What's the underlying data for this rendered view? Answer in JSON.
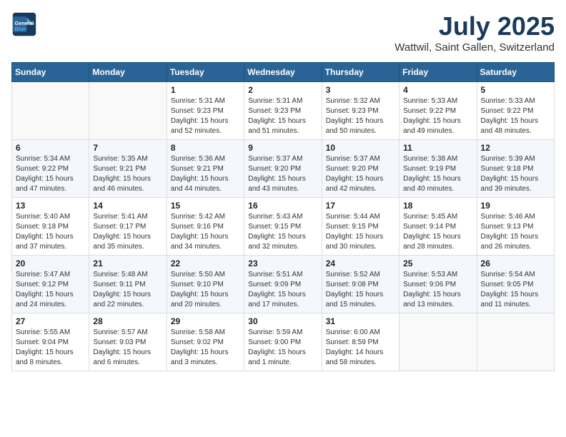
{
  "header": {
    "logo_line1": "General",
    "logo_line2": "Blue",
    "month_year": "July 2025",
    "location": "Wattwil, Saint Gallen, Switzerland"
  },
  "weekdays": [
    "Sunday",
    "Monday",
    "Tuesday",
    "Wednesday",
    "Thursday",
    "Friday",
    "Saturday"
  ],
  "weeks": [
    [
      {
        "day": "",
        "text": ""
      },
      {
        "day": "",
        "text": ""
      },
      {
        "day": "1",
        "text": "Sunrise: 5:31 AM\nSunset: 9:23 PM\nDaylight: 15 hours\nand 52 minutes."
      },
      {
        "day": "2",
        "text": "Sunrise: 5:31 AM\nSunset: 9:23 PM\nDaylight: 15 hours\nand 51 minutes."
      },
      {
        "day": "3",
        "text": "Sunrise: 5:32 AM\nSunset: 9:23 PM\nDaylight: 15 hours\nand 50 minutes."
      },
      {
        "day": "4",
        "text": "Sunrise: 5:33 AM\nSunset: 9:22 PM\nDaylight: 15 hours\nand 49 minutes."
      },
      {
        "day": "5",
        "text": "Sunrise: 5:33 AM\nSunset: 9:22 PM\nDaylight: 15 hours\nand 48 minutes."
      }
    ],
    [
      {
        "day": "6",
        "text": "Sunrise: 5:34 AM\nSunset: 9:22 PM\nDaylight: 15 hours\nand 47 minutes."
      },
      {
        "day": "7",
        "text": "Sunrise: 5:35 AM\nSunset: 9:21 PM\nDaylight: 15 hours\nand 46 minutes."
      },
      {
        "day": "8",
        "text": "Sunrise: 5:36 AM\nSunset: 9:21 PM\nDaylight: 15 hours\nand 44 minutes."
      },
      {
        "day": "9",
        "text": "Sunrise: 5:37 AM\nSunset: 9:20 PM\nDaylight: 15 hours\nand 43 minutes."
      },
      {
        "day": "10",
        "text": "Sunrise: 5:37 AM\nSunset: 9:20 PM\nDaylight: 15 hours\nand 42 minutes."
      },
      {
        "day": "11",
        "text": "Sunrise: 5:38 AM\nSunset: 9:19 PM\nDaylight: 15 hours\nand 40 minutes."
      },
      {
        "day": "12",
        "text": "Sunrise: 5:39 AM\nSunset: 9:18 PM\nDaylight: 15 hours\nand 39 minutes."
      }
    ],
    [
      {
        "day": "13",
        "text": "Sunrise: 5:40 AM\nSunset: 9:18 PM\nDaylight: 15 hours\nand 37 minutes."
      },
      {
        "day": "14",
        "text": "Sunrise: 5:41 AM\nSunset: 9:17 PM\nDaylight: 15 hours\nand 35 minutes."
      },
      {
        "day": "15",
        "text": "Sunrise: 5:42 AM\nSunset: 9:16 PM\nDaylight: 15 hours\nand 34 minutes."
      },
      {
        "day": "16",
        "text": "Sunrise: 5:43 AM\nSunset: 9:15 PM\nDaylight: 15 hours\nand 32 minutes."
      },
      {
        "day": "17",
        "text": "Sunrise: 5:44 AM\nSunset: 9:15 PM\nDaylight: 15 hours\nand 30 minutes."
      },
      {
        "day": "18",
        "text": "Sunrise: 5:45 AM\nSunset: 9:14 PM\nDaylight: 15 hours\nand 28 minutes."
      },
      {
        "day": "19",
        "text": "Sunrise: 5:46 AM\nSunset: 9:13 PM\nDaylight: 15 hours\nand 26 minutes."
      }
    ],
    [
      {
        "day": "20",
        "text": "Sunrise: 5:47 AM\nSunset: 9:12 PM\nDaylight: 15 hours\nand 24 minutes."
      },
      {
        "day": "21",
        "text": "Sunrise: 5:48 AM\nSunset: 9:11 PM\nDaylight: 15 hours\nand 22 minutes."
      },
      {
        "day": "22",
        "text": "Sunrise: 5:50 AM\nSunset: 9:10 PM\nDaylight: 15 hours\nand 20 minutes."
      },
      {
        "day": "23",
        "text": "Sunrise: 5:51 AM\nSunset: 9:09 PM\nDaylight: 15 hours\nand 17 minutes."
      },
      {
        "day": "24",
        "text": "Sunrise: 5:52 AM\nSunset: 9:08 PM\nDaylight: 15 hours\nand 15 minutes."
      },
      {
        "day": "25",
        "text": "Sunrise: 5:53 AM\nSunset: 9:06 PM\nDaylight: 15 hours\nand 13 minutes."
      },
      {
        "day": "26",
        "text": "Sunrise: 5:54 AM\nSunset: 9:05 PM\nDaylight: 15 hours\nand 11 minutes."
      }
    ],
    [
      {
        "day": "27",
        "text": "Sunrise: 5:55 AM\nSunset: 9:04 PM\nDaylight: 15 hours\nand 8 minutes."
      },
      {
        "day": "28",
        "text": "Sunrise: 5:57 AM\nSunset: 9:03 PM\nDaylight: 15 hours\nand 6 minutes."
      },
      {
        "day": "29",
        "text": "Sunrise: 5:58 AM\nSunset: 9:02 PM\nDaylight: 15 hours\nand 3 minutes."
      },
      {
        "day": "30",
        "text": "Sunrise: 5:59 AM\nSunset: 9:00 PM\nDaylight: 15 hours\nand 1 minute."
      },
      {
        "day": "31",
        "text": "Sunrise: 6:00 AM\nSunset: 8:59 PM\nDaylight: 14 hours\nand 58 minutes."
      },
      {
        "day": "",
        "text": ""
      },
      {
        "day": "",
        "text": ""
      }
    ]
  ]
}
